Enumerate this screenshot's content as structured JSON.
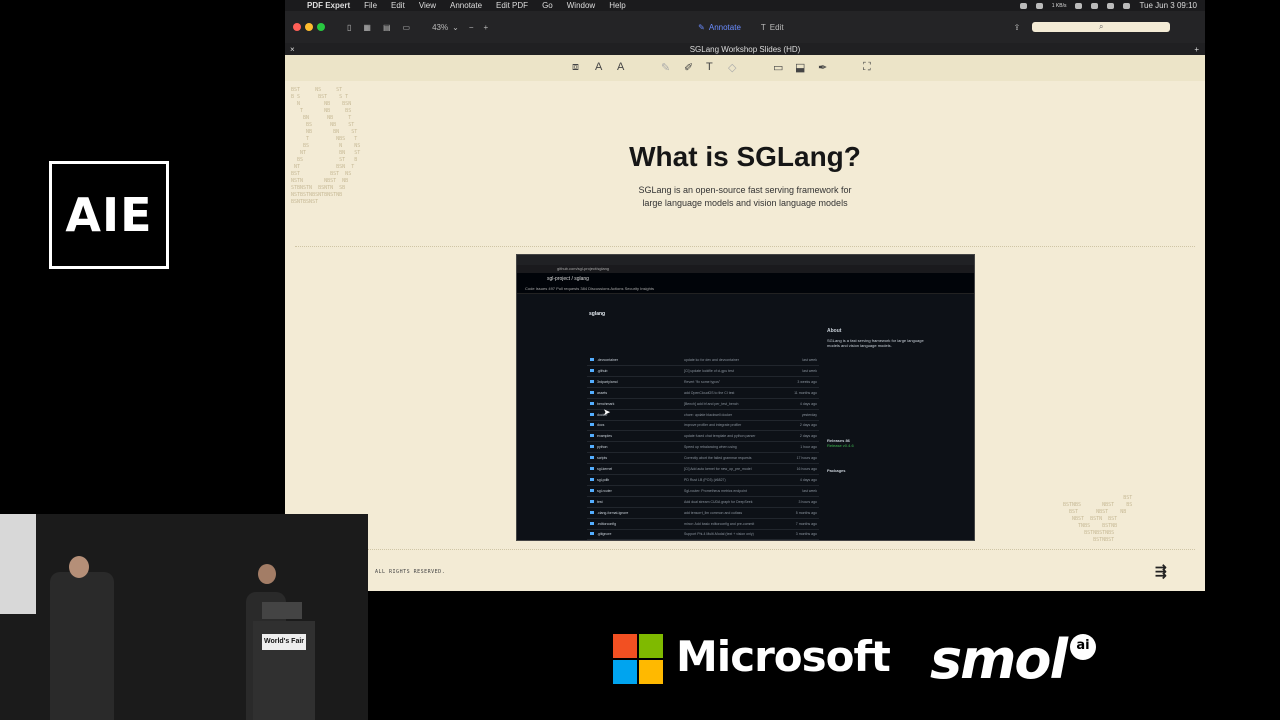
{
  "branding": {
    "aie_logo": "AIE"
  },
  "menubar": {
    "app": "PDF Expert",
    "menus": [
      "File",
      "Edit",
      "View",
      "Annotate",
      "Edit PDF",
      "Go",
      "Window",
      "Help"
    ],
    "clock": "Tue Jun 3  09:10",
    "net": "1 KB/s"
  },
  "toolbar": {
    "zoom": "43%",
    "annotate": "Annotate",
    "edit": "Edit"
  },
  "document": {
    "title": "SGLang Workshop Slides (HD)"
  },
  "slide": {
    "title": "What is SGLang?",
    "subtitle_line1": "SGLang is an open-source fast serving framework for",
    "subtitle_line2": "large language models and vision language models",
    "footer": "ALL RIGHTS RESERVED."
  },
  "github": {
    "url": "github.com/sgl-project/sglang",
    "header": "sgl-project / sglang",
    "tabs": "Code   Issues 497   Pull requests 384   Discussions   Actions   Security   Insights",
    "repo": "sglang",
    "files": [
      {
        "name": ".devcontainer",
        "msg": "update ko for dev and devcontainer",
        "time": "last week"
      },
      {
        "name": ".github",
        "msg": "[CI] update lockfile of ci-gpu test",
        "time": "last week"
      },
      {
        "name": "3rdparty/amd",
        "msg": "Revert \"fix some typos\"",
        "time": "3 weeks ago"
      },
      {
        "name": "assets",
        "msg": "add OpenCloudOS to the CI test",
        "time": "11 months ago"
      },
      {
        "name": "benchmark",
        "msg": "[Bench] add bf and per_test_bench",
        "time": "4 days ago"
      },
      {
        "name": "docker",
        "msg": "chore: update blackwell docker",
        "time": "yesterday"
      },
      {
        "name": "docs",
        "msg": "improve profiler and integrate profiler",
        "time": "2 days ago"
      },
      {
        "name": "examples",
        "msg": "update fused chat template and python parser",
        "time": "2 days ago"
      },
      {
        "name": "python",
        "msg": "Speed up rebalancing when using",
        "time": "1 hour ago"
      },
      {
        "name": "scripts",
        "msg": "Correctly abort the failed grammar requests",
        "time": "17 hours ago"
      },
      {
        "name": "sgl-kernel",
        "msg": "[CI] Add auto kernel for new_op_pre_model",
        "time": "16 hours ago"
      },
      {
        "name": "sgl-pdlb",
        "msg": "PD Rust LB (PO3) (#6827)",
        "time": "4 days ago"
      },
      {
        "name": "sgl-router",
        "msg": "Sgl-router: Prometheus metrics endpoint",
        "time": "last week"
      },
      {
        "name": "test",
        "msg": "Add dual stream CUDA graph for DeepSeek",
        "time": "3 hours ago"
      },
      {
        "name": ".clang-format-ignore",
        "msg": "add tensorrt_llm common and cutlass",
        "time": "5 months ago"
      },
      {
        "name": ".editorconfig",
        "msg": "minor: Add basic editorconfig and pre-commit",
        "time": "7 months ago"
      },
      {
        "name": ".gitignore",
        "msg": "Support Phi-4 Multi-Modal (text + vision only)",
        "time": "3 months ago"
      }
    ],
    "about_title": "About",
    "about_text": "SGLang is a fast serving framework for large language models and vision language models.",
    "releases": "Releases 86",
    "latest": "Release v0.4.6",
    "packages": "Packages"
  },
  "video": {
    "podium_sign": "World's Fair"
  },
  "sponsors": {
    "microsoft": "Microsoft",
    "smol": "smol",
    "smol_ai": "ai"
  },
  "colors": {
    "ms_red": "#f25022",
    "ms_green": "#7fba00",
    "ms_blue": "#00a4ef",
    "ms_yellow": "#ffb900"
  }
}
